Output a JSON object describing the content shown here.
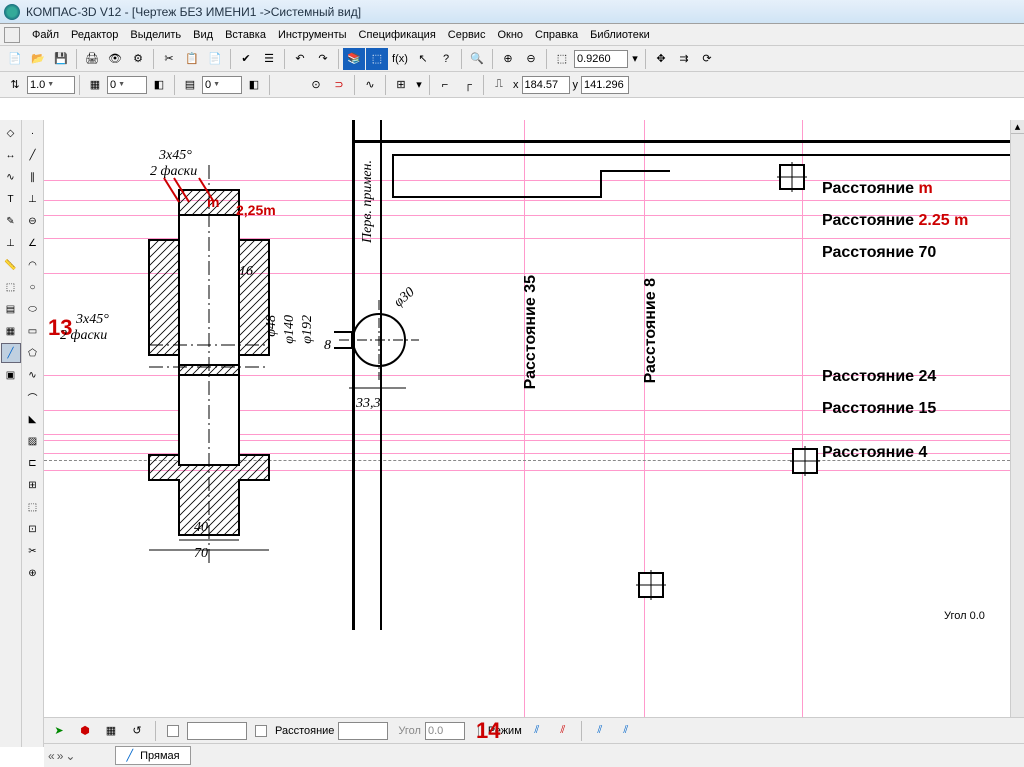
{
  "title": "КОМПАС-3D V12 - [Чертеж БЕЗ ИМЕНИ1 ->Системный вид]",
  "menu": [
    "Файл",
    "Редактор",
    "Выделить",
    "Вид",
    "Вставка",
    "Инструменты",
    "Спецификация",
    "Сервис",
    "Окно",
    "Справка",
    "Библиотеки"
  ],
  "toolbar1": {
    "zoom_val": "0.9260"
  },
  "toolbar2": {
    "scale": "1.0",
    "layer": "0",
    "x_val": "184.57",
    "y_val": "141.296",
    "x_label": "x",
    "y_label": "y"
  },
  "status": {
    "distance_label": "Расстояние",
    "angle_label": "Угол",
    "angle_val": "0.0",
    "mode_label": "Режим"
  },
  "tab": "Прямая",
  "red_callouts": {
    "c13": "13",
    "c14": "14",
    "m": "m",
    "m225": "2,25m"
  },
  "dims": {
    "chamfer1": "3x45°",
    "chamfer1b": "2 фаски",
    "chamfer2": "3x45°",
    "chamfer2b": "2 фаски",
    "d16": "16",
    "d40": "40",
    "d70": "70",
    "d48": "φ48",
    "d140": "φ140",
    "d192": "φ192",
    "d30": "φ30",
    "d8": "8",
    "d333": "33,3",
    "perv": "Перв. примен."
  },
  "annotations": {
    "dist_m": "Расстояние  m",
    "dist_225m": "Расстояние 2.25 m",
    "dist_70": "Расстояние  70",
    "dist_35": "Расстояние 35",
    "dist_8": "Расстояние 8",
    "dist_24": "Расстояние 24",
    "dist_15": "Расстояние 15",
    "dist_4": "Расстояние 4",
    "angle_00": "Угол 0.0"
  }
}
